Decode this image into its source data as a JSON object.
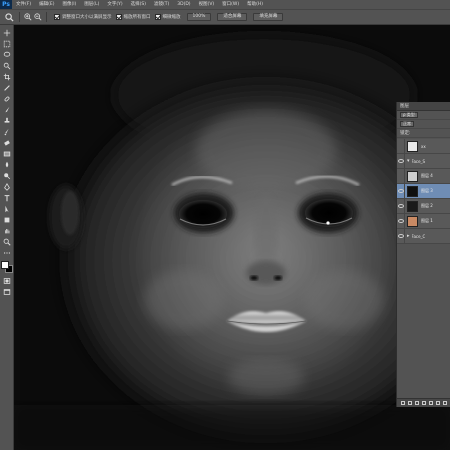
{
  "app": {
    "logo": "Ps"
  },
  "menu": [
    "文件(F)",
    "编辑(E)",
    "图像(I)",
    "图层(L)",
    "文字(Y)",
    "选择(S)",
    "滤镜(T)",
    "3D(D)",
    "视图(V)",
    "窗口(W)",
    "帮助(H)"
  ],
  "options": {
    "tool_icon": "zoom-icon",
    "checkbox_resize": "调整窗口大小以满屏显示",
    "checkbox_all_windows": "缩放所有窗口",
    "checkbox_scrubby": "细微缩放",
    "btn_100": "100%",
    "btn_fit": "适合屏幕",
    "btn_fill": "填充屏幕"
  },
  "layers_panel": {
    "title": "图层",
    "filter_label": "ρ 类型",
    "blend_mode": "正常",
    "lock_label": "锁定:",
    "layers": [
      {
        "name": "xx",
        "visible": false,
        "selected": false,
        "thumb": "#e8e8e8"
      },
      {
        "name": "Face_S",
        "visible": true,
        "selected": false,
        "group": true
      },
      {
        "name": "图层 4",
        "visible": false,
        "selected": false,
        "thumb": "#cfcfcf"
      },
      {
        "name": "图层 3",
        "visible": true,
        "selected": true,
        "thumb": "#101010"
      },
      {
        "name": "图层 2",
        "visible": true,
        "selected": false,
        "thumb": "#1a1a1a"
      },
      {
        "name": "图层 1",
        "visible": true,
        "selected": false,
        "thumb": "#c98a64"
      },
      {
        "name": "Face_C",
        "visible": true,
        "selected": false,
        "group": true
      }
    ]
  },
  "colors": {
    "foreground": "#ffffff",
    "background": "#000000",
    "selection": "#6f8db5"
  }
}
